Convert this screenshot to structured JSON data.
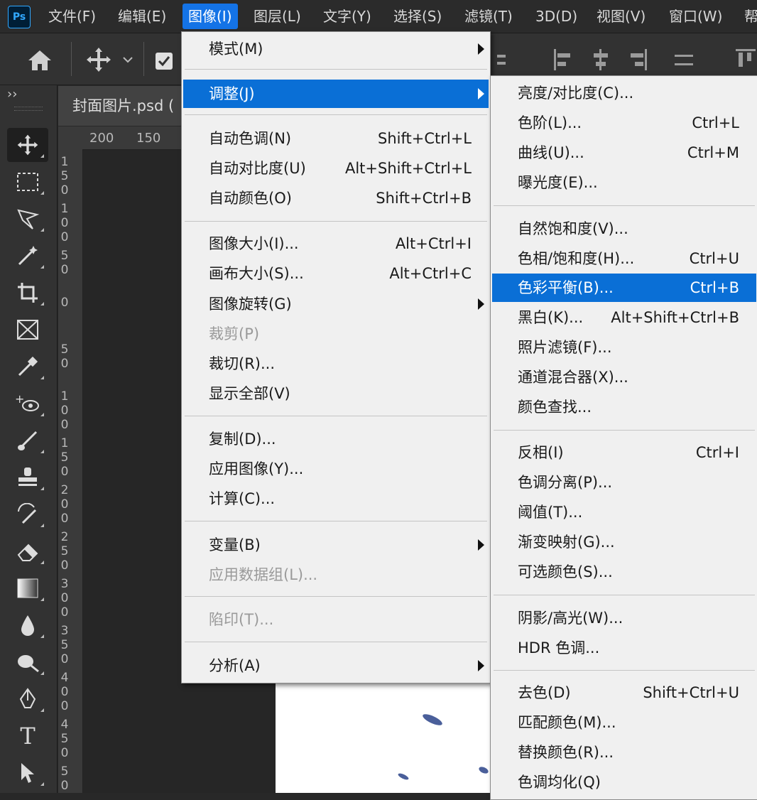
{
  "app": {
    "logo": "Ps"
  },
  "menubar": {
    "items": [
      {
        "label": "文件(F)"
      },
      {
        "label": "编辑(E)"
      },
      {
        "label": "图像(I)"
      },
      {
        "label": "图层(L)"
      },
      {
        "label": "文字(Y)"
      },
      {
        "label": "选择(S)"
      },
      {
        "label": "滤镜(T)"
      },
      {
        "label": "3D(D)"
      },
      {
        "label": "视图(V)"
      },
      {
        "label": "窗口(W)"
      },
      {
        "label": "帮"
      }
    ],
    "active_index": 2,
    "accent_color": "#1473e6"
  },
  "optionsbar": {
    "icons": [
      "home-icon",
      "move-icon",
      "chevron-down-icon",
      "checkbox-icon",
      "align-left-icon",
      "align-center-h-icon",
      "align-right-icon",
      "distribute-icon",
      "align-top-icon"
    ]
  },
  "tools_panel": {
    "collapse_glyph": "››",
    "tools": [
      "move-tool-icon",
      "marquee-tool-icon",
      "lasso-tool-icon",
      "magic-wand-icon",
      "crop-tool-icon",
      "frame-tool-icon",
      "eyedropper-icon",
      "healing-brush-icon",
      "brush-tool-icon",
      "clone-stamp-icon",
      "history-brush-icon",
      "eraser-icon",
      "gradient-tool-icon",
      "blur-tool-icon",
      "dodge-tool-icon",
      "pen-tool-icon",
      "type-tool-icon",
      "path-select-icon"
    ],
    "type_glyph": "T"
  },
  "document": {
    "tab_title": "封面图片.psd (",
    "ruler_h": [
      "200",
      "150"
    ],
    "ruler_v": [
      "150",
      "100",
      "50",
      "0",
      "50",
      "100",
      "150",
      "200",
      "250",
      "300",
      "350",
      "400",
      "450",
      "50"
    ]
  },
  "image_menu": {
    "items": [
      {
        "label": "模式(M)",
        "submenu": true
      },
      {
        "label": "调整(J)",
        "submenu": true,
        "highlighted": true
      },
      {
        "label": "自动色调(N)",
        "shortcut": "Shift+Ctrl+L"
      },
      {
        "label": "自动对比度(U)",
        "shortcut": "Alt+Shift+Ctrl+L"
      },
      {
        "label": "自动颜色(O)",
        "shortcut": "Shift+Ctrl+B"
      },
      {
        "label": "图像大小(I)...",
        "shortcut": "Alt+Ctrl+I"
      },
      {
        "label": "画布大小(S)...",
        "shortcut": "Alt+Ctrl+C"
      },
      {
        "label": "图像旋转(G)",
        "submenu": true
      },
      {
        "label": "裁剪(P)",
        "disabled": true
      },
      {
        "label": "裁切(R)..."
      },
      {
        "label": "显示全部(V)"
      },
      {
        "label": "复制(D)..."
      },
      {
        "label": "应用图像(Y)..."
      },
      {
        "label": "计算(C)..."
      },
      {
        "label": "变量(B)",
        "submenu": true
      },
      {
        "label": "应用数据组(L)...",
        "disabled": true
      },
      {
        "label": "陷印(T)...",
        "disabled": true
      },
      {
        "label": "分析(A)",
        "submenu": true
      }
    ]
  },
  "adjust_menu": {
    "items": [
      {
        "label": "亮度/对比度(C)..."
      },
      {
        "label": "色阶(L)...",
        "shortcut": "Ctrl+L"
      },
      {
        "label": "曲线(U)...",
        "shortcut": "Ctrl+M"
      },
      {
        "label": "曝光度(E)..."
      },
      {
        "label": "自然饱和度(V)..."
      },
      {
        "label": "色相/饱和度(H)...",
        "shortcut": "Ctrl+U"
      },
      {
        "label": "色彩平衡(B)...",
        "shortcut": "Ctrl+B",
        "highlighted": true
      },
      {
        "label": "黑白(K)...",
        "shortcut": "Alt+Shift+Ctrl+B"
      },
      {
        "label": "照片滤镜(F)..."
      },
      {
        "label": "通道混合器(X)..."
      },
      {
        "label": "颜色查找..."
      },
      {
        "label": "反相(I)",
        "shortcut": "Ctrl+I"
      },
      {
        "label": "色调分离(P)..."
      },
      {
        "label": "阈值(T)..."
      },
      {
        "label": "渐变映射(G)..."
      },
      {
        "label": "可选颜色(S)..."
      },
      {
        "label": "阴影/高光(W)..."
      },
      {
        "label": "HDR 色调..."
      },
      {
        "label": "去色(D)",
        "shortcut": "Shift+Ctrl+U"
      },
      {
        "label": "匹配颜色(M)..."
      },
      {
        "label": "替换颜色(R)..."
      },
      {
        "label": "色调均化(Q)"
      }
    ]
  },
  "colors": {
    "menu_bg": "#f0f0f0",
    "highlight": "#0a6fd6",
    "disabled_text": "#9a9a9a",
    "panel_bg": "#323232"
  }
}
